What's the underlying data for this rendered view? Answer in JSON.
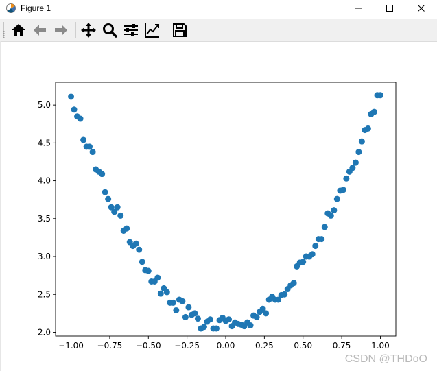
{
  "window": {
    "title": "Figure 1",
    "controls": [
      "minimize",
      "maximize",
      "close"
    ]
  },
  "toolbar": {
    "buttons": [
      {
        "icon": "home-icon",
        "action": "home"
      },
      {
        "icon": "arrow-left-icon",
        "action": "back"
      },
      {
        "icon": "arrow-right-icon",
        "action": "forward"
      },
      {
        "icon": "move-icon",
        "action": "pan"
      },
      {
        "icon": "magnifier-icon",
        "action": "zoom"
      },
      {
        "icon": "sliders-icon",
        "action": "configure-subplots"
      },
      {
        "icon": "line-chart-icon",
        "action": "edit-axis"
      },
      {
        "icon": "floppy-disk-icon",
        "action": "save"
      }
    ]
  },
  "colors": {
    "marker": "#1f77b4",
    "toolbar_bg": "#f0f0f0"
  },
  "watermark": "CSDN @THDoO",
  "chart_data": {
    "type": "scatter",
    "title": "",
    "xlabel": "",
    "ylabel": "",
    "xlim": [
      -1.1,
      1.1
    ],
    "ylim": [
      1.95,
      5.3
    ],
    "xticks": [
      -1.0,
      -0.75,
      -0.5,
      -0.25,
      0.0,
      0.25,
      0.5,
      0.75,
      1.0
    ],
    "xtick_labels": [
      "−1.00",
      "−0.75",
      "−0.50",
      "−0.25",
      "0.00",
      "0.25",
      "0.50",
      "0.75",
      "1.00"
    ],
    "yticks": [
      2.0,
      2.5,
      3.0,
      3.5,
      4.0,
      4.5,
      5.0
    ],
    "ytick_labels": [
      "2.0",
      "2.5",
      "3.0",
      "3.5",
      "4.0",
      "4.5",
      "5.0"
    ],
    "grid": false,
    "legend": "none",
    "x": [
      -1.0,
      -0.98,
      -0.96,
      -0.94,
      -0.92,
      -0.9,
      -0.88,
      -0.86,
      -0.84,
      -0.82,
      -0.8,
      -0.78,
      -0.76,
      -0.74,
      -0.72,
      -0.7,
      -0.68,
      -0.66,
      -0.64,
      -0.62,
      -0.6,
      -0.58,
      -0.56,
      -0.54,
      -0.52,
      -0.5,
      -0.48,
      -0.46,
      -0.44,
      -0.42,
      -0.4,
      -0.38,
      -0.36,
      -0.34,
      -0.32,
      -0.3,
      -0.28,
      -0.26,
      -0.24,
      -0.22,
      -0.2,
      -0.18,
      -0.16,
      -0.14,
      -0.12,
      -0.1,
      -0.08,
      -0.06,
      -0.04,
      -0.02,
      0.0,
      0.02,
      0.04,
      0.06,
      0.08,
      0.1,
      0.12,
      0.14,
      0.16,
      0.18,
      0.2,
      0.22,
      0.24,
      0.26,
      0.28,
      0.3,
      0.32,
      0.34,
      0.36,
      0.38,
      0.4,
      0.42,
      0.44,
      0.46,
      0.48,
      0.5,
      0.52,
      0.54,
      0.56,
      0.58,
      0.6,
      0.62,
      0.64,
      0.66,
      0.68,
      0.7,
      0.72,
      0.74,
      0.76,
      0.78,
      0.8,
      0.82,
      0.84,
      0.86,
      0.88,
      0.9,
      0.92,
      0.94,
      0.96,
      0.98,
      1.0
    ],
    "y": [
      5.11,
      4.94,
      4.85,
      4.82,
      4.54,
      4.45,
      4.45,
      4.38,
      4.15,
      4.12,
      4.09,
      3.85,
      3.76,
      3.65,
      3.59,
      3.65,
      3.54,
      3.34,
      3.37,
      3.19,
      3.14,
      3.17,
      3.09,
      2.93,
      2.82,
      2.81,
      2.67,
      2.67,
      2.72,
      2.51,
      2.58,
      2.53,
      2.39,
      2.39,
      2.29,
      2.43,
      2.41,
      2.2,
      2.33,
      2.23,
      2.25,
      2.18,
      2.05,
      2.07,
      2.14,
      2.17,
      2.05,
      2.05,
      2.16,
      2.19,
      2.15,
      2.17,
      2.08,
      2.13,
      2.11,
      2.1,
      2.08,
      2.13,
      2.09,
      2.22,
      2.2,
      2.27,
      2.31,
      2.25,
      2.43,
      2.47,
      2.43,
      2.43,
      2.49,
      2.5,
      2.57,
      2.62,
      2.65,
      2.87,
      2.92,
      2.93,
      3.0,
      3.0,
      3.03,
      3.14,
      3.23,
      3.23,
      3.39,
      3.57,
      3.54,
      3.61,
      3.76,
      3.87,
      3.88,
      4.03,
      4.12,
      4.17,
      4.24,
      4.38,
      4.52,
      4.67,
      4.69,
      4.88,
      4.91,
      5.13,
      5.13
    ]
  }
}
